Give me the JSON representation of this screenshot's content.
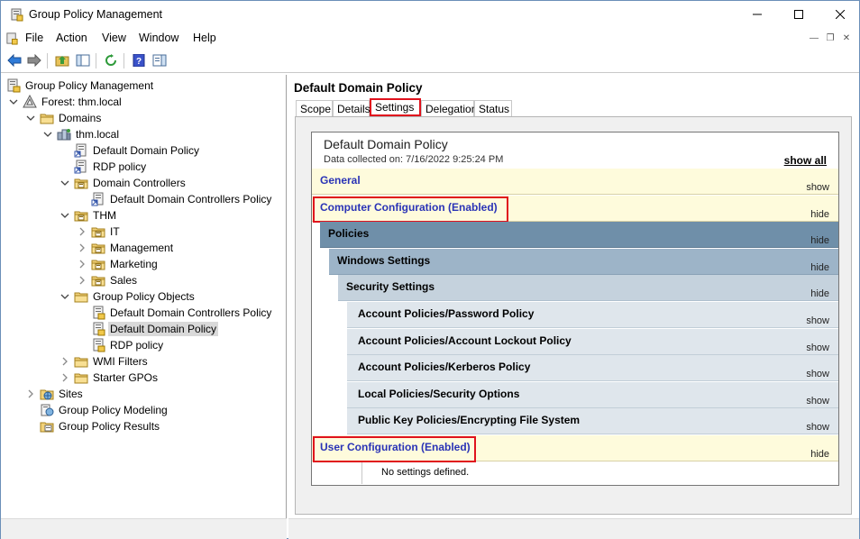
{
  "window": {
    "title": "Group Policy Management"
  },
  "menu": [
    "File",
    "Action",
    "View",
    "Window",
    "Help"
  ],
  "tree": [
    {
      "label": "Group Policy Management",
      "depth": 0,
      "expander": "",
      "icon": "gpm-icon"
    },
    {
      "label": "Forest: thm.local",
      "depth": 1,
      "expander": "open",
      "icon": "forest-icon"
    },
    {
      "label": "Domains",
      "depth": 2,
      "expander": "open",
      "icon": "folder-icon"
    },
    {
      "label": "thm.local",
      "depth": 3,
      "expander": "open",
      "icon": "domain-icon"
    },
    {
      "label": "Default Domain Policy",
      "depth": 4,
      "expander": "",
      "icon": "gpo-link-icon"
    },
    {
      "label": "RDP policy",
      "depth": 4,
      "expander": "",
      "icon": "gpo-link-icon"
    },
    {
      "label": "Domain Controllers",
      "depth": 4,
      "expander": "open",
      "icon": "ou-icon"
    },
    {
      "label": "Default Domain Controllers Policy",
      "depth": 5,
      "expander": "",
      "icon": "gpo-link-icon"
    },
    {
      "label": "THM",
      "depth": 4,
      "expander": "open",
      "icon": "ou-icon"
    },
    {
      "label": "IT",
      "depth": 5,
      "expander": "closed",
      "icon": "ou-icon"
    },
    {
      "label": "Management",
      "depth": 5,
      "expander": "closed",
      "icon": "ou-icon"
    },
    {
      "label": "Marketing",
      "depth": 5,
      "expander": "closed",
      "icon": "ou-icon"
    },
    {
      "label": "Sales",
      "depth": 5,
      "expander": "closed",
      "icon": "ou-icon"
    },
    {
      "label": "Group Policy Objects",
      "depth": 4,
      "expander": "open",
      "icon": "folder-icon"
    },
    {
      "label": "Default Domain Controllers Policy",
      "depth": 5,
      "expander": "",
      "icon": "gpo-icon"
    },
    {
      "label": "Default Domain Policy",
      "depth": 5,
      "expander": "",
      "icon": "gpo-icon",
      "selected": true
    },
    {
      "label": "RDP policy",
      "depth": 5,
      "expander": "",
      "icon": "gpo-icon"
    },
    {
      "label": "WMI Filters",
      "depth": 4,
      "expander": "closed",
      "icon": "folder-icon"
    },
    {
      "label": "Starter GPOs",
      "depth": 4,
      "expander": "closed",
      "icon": "folder-icon"
    },
    {
      "label": "Sites",
      "depth": 2,
      "expander": "closed",
      "icon": "sites-icon"
    },
    {
      "label": "Group Policy Modeling",
      "depth": 2,
      "expander": "",
      "icon": "modeling-icon"
    },
    {
      "label": "Group Policy Results",
      "depth": 2,
      "expander": "",
      "icon": "results-icon"
    }
  ],
  "details": {
    "title": "Default Domain Policy",
    "tabs": [
      {
        "label": "Scope",
        "active": false
      },
      {
        "label": "Details",
        "active": false
      },
      {
        "label": "Settings",
        "active": true
      },
      {
        "label": "Delegation",
        "active": false
      },
      {
        "label": "Status",
        "active": false
      }
    ],
    "report": {
      "title": "Default Domain Policy",
      "collected": "Data collected on: 7/16/2022 9:25:24 PM",
      "show_all": "show all",
      "bands": [
        {
          "label": "General",
          "action": "show",
          "level": 0,
          "style": "section"
        },
        {
          "label": "Computer Configuration (Enabled)",
          "action": "hide",
          "level": 0,
          "style": "section",
          "highlight": true
        },
        {
          "label": "Policies",
          "action": "hide",
          "level": 1,
          "style": "dark"
        },
        {
          "label": "Windows Settings",
          "action": "hide",
          "level": 2,
          "style": "mid"
        },
        {
          "label": "Security Settings",
          "action": "hide",
          "level": 3,
          "style": "light"
        },
        {
          "label": "Account Policies/Password Policy",
          "action": "show",
          "level": 4,
          "style": "leaf"
        },
        {
          "label": "Account Policies/Account Lockout Policy",
          "action": "show",
          "level": 4,
          "style": "leaf"
        },
        {
          "label": "Account Policies/Kerberos Policy",
          "action": "show",
          "level": 4,
          "style": "leaf"
        },
        {
          "label": "Local Policies/Security Options",
          "action": "show",
          "level": 4,
          "style": "leaf"
        },
        {
          "label": "Public Key Policies/Encrypting File System",
          "action": "show",
          "level": 4,
          "style": "leaf"
        },
        {
          "label": "User Configuration (Enabled)",
          "action": "hide",
          "level": 0,
          "style": "section",
          "highlight": true
        }
      ],
      "no_settings": "No settings defined."
    }
  },
  "colors": {
    "highlight_red": "#e0121d",
    "section_bg": "#fefbdc",
    "section_text": "#2a33b6",
    "policies_bg": "#6f8fa9",
    "windows_bg": "#9db4c8",
    "security_bg": "#c5d2dd",
    "leaf_bg": "#dfe6ec"
  }
}
